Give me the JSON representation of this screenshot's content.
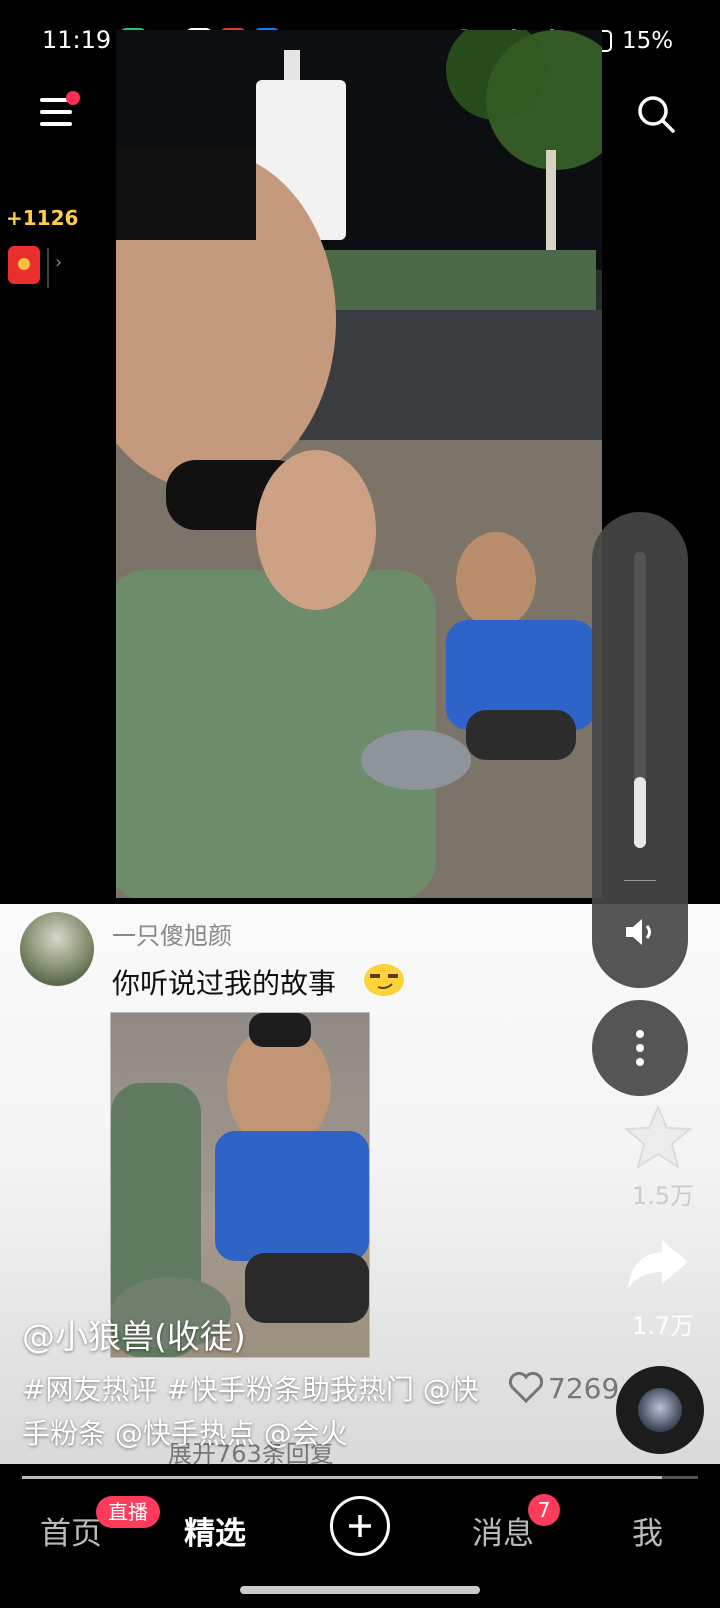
{
  "status_bar": {
    "time": "11:19",
    "battery_percent": "15%",
    "icons": [
      "app-icon-green",
      "wechat-icon",
      "video-app-icon",
      "red-app-icon",
      "alipay-icon",
      "dot-icon",
      "hd-icon",
      "wifi-icon",
      "signal-4g-icon",
      "signal-4g-icon",
      "battery-low-icon"
    ]
  },
  "header": {
    "coins": "+1126",
    "icons": [
      "menu-icon",
      "search-icon",
      "red-packet-icon",
      "chevron-right-icon"
    ]
  },
  "comment": {
    "username": "一只傻旭颜",
    "text": "你听说过我的故事",
    "emoji": "smirk-emoji",
    "likes": "7269",
    "expand_text": "展开763条回复"
  },
  "post": {
    "author": "@小狼兽(收徒)",
    "caption_line1": "#网友热评 #快手粉条助我热门 @快",
    "caption_line2": "手粉条 @快手热点 @会火"
  },
  "right_rail": {
    "star_count": "1.5万",
    "share_count": "1.7万",
    "volume_level": 0.24
  },
  "nav": {
    "home": "首页",
    "live_badge": "直播",
    "featured": "精选",
    "messages": "消息",
    "messages_badge": "7",
    "me": "我"
  },
  "colors": {
    "accent": "#ff3b5c",
    "coin": "#ffcf4a"
  }
}
